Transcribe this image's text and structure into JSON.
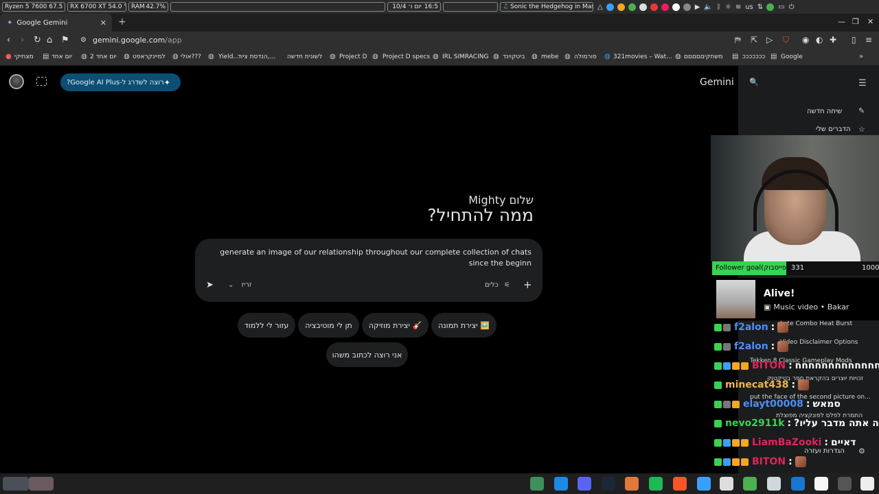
{
  "system_bar": {
    "cpu": "Ryzen 5 7600  67.5 °C",
    "gpu": "RX 6700 XT  54.0 °C",
    "ram_label": "RAM",
    "ram_value": "42.7%",
    "clock": "16:5",
    "date": "יום ו׳ 10/4",
    "media": "Sonic the Hedgehog in Mas...",
    "lang": "us"
  },
  "browser": {
    "tab_title": "Google Gemini",
    "new_tab": "+",
    "url_host": "gemini.google.com",
    "url_path": "/app",
    "bookmarks": [
      "מצחיקי",
      "יום אחד",
      "יום אחד 2",
      "למיינקראפט",
      "אולי???",
      "Yield...",
      "הנדסת ציוד,...",
      "לשונית חדשה",
      "Project D",
      "Project D specs",
      "IRL SIMRACING",
      "ביטקוינד",
      "mebe",
      "פורמולה",
      "321movies – Wat...",
      "משחקיםםםםם",
      "כככככככ",
      "Google"
    ]
  },
  "gemini": {
    "app_title": "Gemini",
    "upgrade_label": "רוצה לשדרג ל-Google AI Plus?",
    "greeting": "שלום Mighty",
    "headline": "ממה להתחיל?",
    "prompt_text": "generate an image of our relationship throughout our complete collection of chats since the beginn",
    "model_label": "זריז",
    "tools_label": "כלים",
    "chips": [
      "🖼️ יצירת תמונה",
      "🎸 יצירת מוזיקה",
      "תן לי מוטיבציה",
      "עזור לי ללמוד",
      "אני רוצה לכתוב משהו"
    ],
    "sidebar": {
      "new_chat": "שיחה חדשה",
      "my_stuff": "הדברים שלי",
      "settings": "הגדרות ועזרה"
    }
  },
  "stream_overlay": {
    "follower_label": "Follower goal(פייסבוק):",
    "follower_current": 331,
    "follower_target": 1000,
    "music_title": "Alive!",
    "music_sub": "Music video • Bakar",
    "chat": [
      {
        "user": "f2alon",
        "msg": "",
        "color": "#4f8ff7"
      },
      {
        "user": "f2alon",
        "msg": "",
        "color": "#4f8ff7"
      },
      {
        "user": "BITON",
        "msg": "חחחחחחחחחחחחח",
        "color": "#e0245e"
      },
      {
        "user": "minecat438",
        "msg": "",
        "color": "#f0b64a"
      },
      {
        "user": "elayt00008",
        "msg": "סמאש",
        "color": "#4f8ff7"
      },
      {
        "user": "nevo2911k",
        "msg": "?ככה אתה מדבר עליו",
        "color": "#39d353"
      },
      {
        "user": "LiamBaZooki",
        "msg": "דאיים",
        "color": "#e0245e"
      },
      {
        "user": "BITON",
        "msg": "",
        "color": "#e0245e"
      }
    ],
    "ghost_lines": [
      "Late Combo Heat Burst",
      "Video Disclaimer Options",
      "Tekken 8 Classic Gameplay Mods",
      "זכויות יוצרים בהקראת ספר בטיקטוק",
      "put the face of the second picture on...",
      "התמרת לפלס לפונקציה מפוצלת"
    ]
  }
}
